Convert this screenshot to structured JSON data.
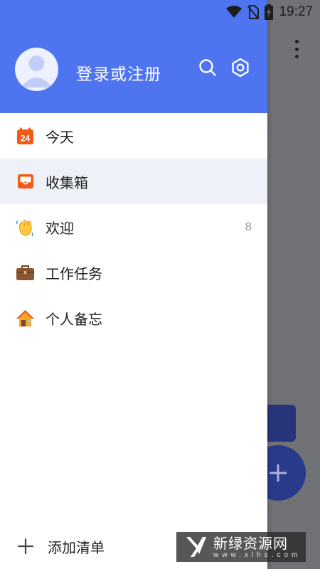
{
  "status_bar": {
    "time": "19:27",
    "icons": [
      "wifi-icon",
      "no-sim-icon",
      "battery-charging-icon"
    ]
  },
  "drawer": {
    "header": {
      "login_label": "登录或注册",
      "icons": [
        "search-icon",
        "settings-icon"
      ],
      "background_color": "#4e74f0"
    },
    "items": [
      {
        "label": "今天",
        "icon": "calendar-icon",
        "icon_text": "24",
        "count": ""
      },
      {
        "label": "收集箱",
        "icon": "inbox-icon",
        "count": "",
        "selected": true
      },
      {
        "label": "欢迎",
        "icon": "waving-hand-icon",
        "count": "8"
      },
      {
        "label": "工作任务",
        "icon": "briefcase-icon",
        "count": ""
      },
      {
        "label": "个人备忘",
        "icon": "house-icon",
        "count": ""
      }
    ],
    "add_list_label": "添加清单"
  },
  "watermark": {
    "title": "新绿资源网",
    "subtitle": "www.xlhs.com"
  }
}
